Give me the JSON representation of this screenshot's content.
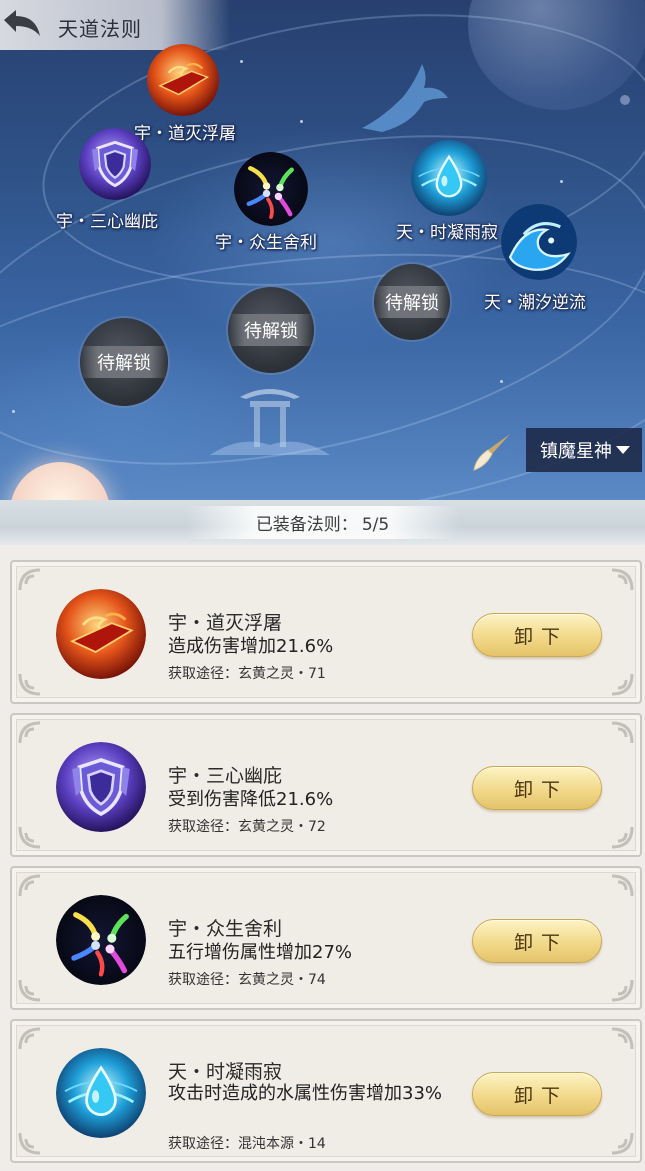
{
  "header": {
    "title": "天道法则",
    "back_icon": "back-arrow-icon"
  },
  "map": {
    "nodes": [
      {
        "label": "宇・道灭浮屠",
        "icon": "red-ship-icon"
      },
      {
        "label": "宇・三心幽庇",
        "icon": "shield-icon"
      },
      {
        "label": "宇・众生舍利",
        "icon": "comet-orbs-icon"
      },
      {
        "label": "天・时凝雨寂",
        "icon": "water-drop-icon"
      },
      {
        "label": "天・潮汐逆流",
        "icon": "tide-wave-icon"
      }
    ],
    "locked": [
      {
        "label": "待解锁"
      },
      {
        "label": "待解锁"
      },
      {
        "label": "待解锁"
      }
    ],
    "brush_icon": "brush-icon",
    "dropdown": {
      "selected": "镇魔星神"
    }
  },
  "equipped": {
    "label": "已装备法则：",
    "count": "5/5"
  },
  "cards": [
    {
      "name": "宇・道灭浮屠",
      "effect": "造成伤害增加21.6%",
      "source": "获取途径：玄黄之灵・71",
      "button": "卸下",
      "icon": "red-ship-icon"
    },
    {
      "name": "宇・三心幽庇",
      "effect": "受到伤害降低21.6%",
      "source": "获取途径：玄黄之灵・72",
      "button": "卸下",
      "icon": "shield-icon"
    },
    {
      "name": "宇・众生舍利",
      "effect": "五行增伤属性增加27%",
      "source": "获取途径：玄黄之灵・74",
      "button": "卸下",
      "icon": "comet-orbs-icon"
    },
    {
      "name": "天・时凝雨寂",
      "effect": "攻击时造成的水属性伤害增加33%",
      "source": "获取途径：混沌本源・14",
      "button": "卸下",
      "icon": "water-drop-icon"
    }
  ]
}
